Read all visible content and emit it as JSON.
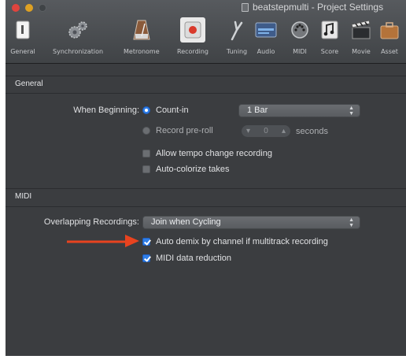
{
  "window": {
    "title": "beatstepmulti - Project Settings"
  },
  "toolbar": {
    "items": [
      {
        "label": "General"
      },
      {
        "label": "Synchronization"
      },
      {
        "label": "Metronome"
      },
      {
        "label": "Recording"
      },
      {
        "label": "Tuning"
      },
      {
        "label": "Audio"
      },
      {
        "label": "MIDI"
      },
      {
        "label": "Score"
      },
      {
        "label": "Movie"
      },
      {
        "label": "Asset"
      }
    ],
    "selected": "Recording"
  },
  "general": {
    "header": "General",
    "when_beginning_label": "When Beginning:",
    "count_in_label": "Count-in",
    "count_in_selected": true,
    "count_in_value": "1 Bar",
    "record_preroll_label": "Record pre-roll",
    "preroll_value": "0",
    "preroll_unit": "seconds",
    "allow_tempo_label": "Allow tempo change recording",
    "allow_tempo_checked": false,
    "auto_colorize_label": "Auto-colorize takes",
    "auto_colorize_checked": false
  },
  "midi": {
    "header": "MIDI",
    "overlapping_label": "Overlapping Recordings:",
    "overlapping_value": "Join when Cycling",
    "auto_demix_label": "Auto demix by channel if multitrack recording",
    "auto_demix_checked": true,
    "data_reduction_label": "MIDI data reduction",
    "data_reduction_checked": true
  },
  "annotation": {
    "arrow_color": "#e8431f"
  }
}
